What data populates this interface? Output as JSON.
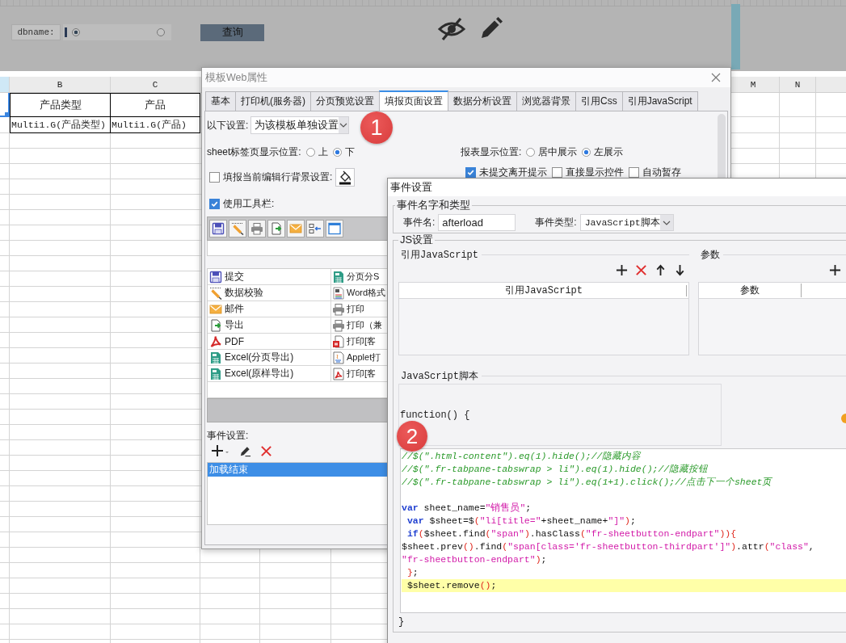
{
  "header": {
    "field_label": "dbname:",
    "radios": [
      {
        "selected": true
      },
      {
        "selected": false
      }
    ],
    "query_button": "查询"
  },
  "sheet": {
    "first_column": {
      "selected": true
    },
    "columns": [
      {
        "label": "B"
      },
      {
        "label": "C"
      },
      {
        "label": "M"
      },
      {
        "label": "N"
      }
    ],
    "rows": [
      {
        "kind": "heading",
        "cells": [
          "产品类型",
          "产品"
        ]
      },
      {
        "kind": "data",
        "cells": [
          "Multi1.G(产品类型)",
          "Multi1.G(产品)"
        ]
      }
    ]
  },
  "web_dialog": {
    "title": "模板Web属性",
    "tabs": [
      {
        "label": "基本",
        "selected": false
      },
      {
        "label": "打印机(服务器)",
        "selected": false
      },
      {
        "label": "分页预览设置",
        "selected": false
      },
      {
        "label": "填报页面设置",
        "selected": true
      },
      {
        "label": "数据分析设置",
        "selected": false
      },
      {
        "label": "浏览器背景",
        "selected": false
      },
      {
        "label": "引用Css",
        "selected": false
      },
      {
        "label": "引用JavaScript",
        "selected": false
      }
    ],
    "template_setting": {
      "label": "以下设置:",
      "value": "为该模板单独设置",
      "badge": "1"
    },
    "sheet_tab_position": {
      "label": "sheet标签页显示位置:",
      "options": [
        {
          "label": "上",
          "selected": false
        },
        {
          "label": "下",
          "selected": true
        }
      ]
    },
    "report_position": {
      "label": "报表显示位置:",
      "options": [
        {
          "label": "居中展示",
          "selected": false
        },
        {
          "label": "左展示",
          "selected": true
        }
      ]
    },
    "row_background": {
      "label": "填报当前编辑行背景设置:",
      "checked": false
    },
    "leave_options": [
      {
        "label": "未提交离开提示",
        "checked": true
      },
      {
        "label": "直接显示控件",
        "checked": false
      },
      {
        "label": "自动暂存",
        "checked": false
      }
    ],
    "use_toolbar": {
      "label": "使用工具栏:",
      "checked": true
    },
    "button_rows": [
      {
        "cells": [
          {
            "kind": "submit",
            "label": "提交"
          },
          {
            "kind": "excel",
            "label": "分页分S"
          }
        ]
      },
      {
        "cells": [
          {
            "kind": "verify",
            "label": "数据校验"
          },
          {
            "kind": "word",
            "label": "Word格式"
          }
        ]
      },
      {
        "cells": [
          {
            "kind": "email",
            "label": "邮件"
          },
          {
            "kind": "print",
            "label": "打印"
          }
        ]
      },
      {
        "cells": [
          {
            "kind": "export",
            "label": "导出"
          },
          {
            "kind": "print",
            "label": "打印（兼"
          }
        ]
      },
      {
        "cells": [
          {
            "kind": "pdf",
            "label": "PDF"
          },
          {
            "kind": "flash",
            "label": "打印[客"
          }
        ]
      },
      {
        "cells": [
          {
            "kind": "excel",
            "label": "Excel(分页导出)"
          },
          {
            "kind": "applet",
            "label": "Applet打"
          }
        ]
      },
      {
        "cells": [
          {
            "kind": "excel",
            "label": "Excel(原样导出)"
          },
          {
            "kind": "pdf_print",
            "label": "打印[客"
          }
        ]
      }
    ],
    "events": {
      "label": "事件设置:",
      "items": [
        {
          "label": "加载结束",
          "selected": true
        }
      ]
    }
  },
  "event_dialog": {
    "title": "事件设置",
    "name_group": {
      "legend": "事件名字和类型",
      "name_label": "事件名:",
      "name_value": "afterload",
      "type_label": "事件类型:",
      "type_value": "JavaScript脚本"
    },
    "js_group": {
      "legend": "JS设置",
      "references": {
        "label": "引用JavaScript",
        "column": "引用JavaScript"
      },
      "parameters": {
        "label": "参数",
        "column": "参数"
      },
      "script": {
        "label": "JavaScript脚本",
        "header_line": "function() {",
        "badge": "2",
        "footer_line": "}",
        "lines": [
          {
            "highlighted": false,
            "tokens": [
              {
                "kind": "comment",
                "text": "//$(\".html-content\").eq(1).hide();//隐藏内容"
              }
            ]
          },
          {
            "highlighted": false,
            "tokens": [
              {
                "kind": "comment",
                "text": "//$(\".fr-tabpane-tabswrap > li\").eq(1).hide();//隐藏按钮"
              }
            ]
          },
          {
            "highlighted": false,
            "tokens": [
              {
                "kind": "comment",
                "text": "//$(\".fr-tabpane-tabswrap > li\").eq(1+1).click();//点击下一个sheet页"
              }
            ]
          },
          {
            "highlighted": false
          },
          {
            "highlighted": false,
            "tokens": [
              {
                "kind": "keyword",
                "text": "var"
              },
              {
                "kind": "plain",
                "text": " sheet_name="
              },
              {
                "kind": "string",
                "text": "\"销售员\""
              },
              {
                "kind": "plain",
                "text": ";"
              }
            ]
          },
          {
            "highlighted": false,
            "tokens": [
              {
                "kind": "keyword",
                "text": " var"
              },
              {
                "kind": "plain",
                "text": " $sheet=$"
              },
              {
                "kind": "paren",
                "text": "("
              },
              {
                "kind": "string",
                "text": "\"li[title=\""
              },
              {
                "kind": "plain",
                "text": "+sheet_name+"
              },
              {
                "kind": "string",
                "text": "\"]\""
              },
              {
                "kind": "paren",
                "text": ")"
              },
              {
                "kind": "plain",
                "text": ";"
              }
            ]
          },
          {
            "highlighted": false,
            "tokens": [
              {
                "kind": "keyword",
                "text": " if"
              },
              {
                "kind": "paren",
                "text": "("
              },
              {
                "kind": "plain",
                "text": "$sheet.find"
              },
              {
                "kind": "paren",
                "text": "("
              },
              {
                "kind": "string",
                "text": "\"span\""
              },
              {
                "kind": "paren",
                "text": ")"
              },
              {
                "kind": "plain",
                "text": ".hasClass"
              },
              {
                "kind": "paren",
                "text": "("
              },
              {
                "kind": "string",
                "text": "\"fr-sheetbutton-endpart\""
              },
              {
                "kind": "paren",
                "text": ")){"
              }
            ]
          },
          {
            "highlighted": false,
            "tokens": [
              {
                "kind": "plain",
                "text": "$sheet.prev"
              },
              {
                "kind": "paren",
                "text": "()"
              },
              {
                "kind": "plain",
                "text": ".find"
              },
              {
                "kind": "paren",
                "text": "("
              },
              {
                "kind": "string",
                "text": "\"span[class='fr-sheetbutton-thirdpart']\""
              },
              {
                "kind": "paren",
                "text": ")"
              },
              {
                "kind": "plain",
                "text": ".attr"
              },
              {
                "kind": "paren",
                "text": "("
              },
              {
                "kind": "string",
                "text": "\"class\""
              },
              {
                "kind": "plain",
                "text": ","
              }
            ]
          },
          {
            "highlighted": false,
            "tokens": [
              {
                "kind": "string",
                "text": "\"fr-sheetbutton-endpart\""
              },
              {
                "kind": "paren",
                "text": ")"
              },
              {
                "kind": "plain",
                "text": ";"
              }
            ]
          },
          {
            "highlighted": false,
            "tokens": [
              {
                "kind": "paren",
                "text": " }"
              },
              {
                "kind": "plain",
                "text": ";"
              }
            ]
          },
          {
            "highlighted": true,
            "tokens": [
              {
                "kind": "plain",
                "text": " $sheet.remove"
              },
              {
                "kind": "paren",
                "text": "()"
              },
              {
                "kind": "plain",
                "text": ";"
              }
            ]
          }
        ]
      }
    }
  }
}
